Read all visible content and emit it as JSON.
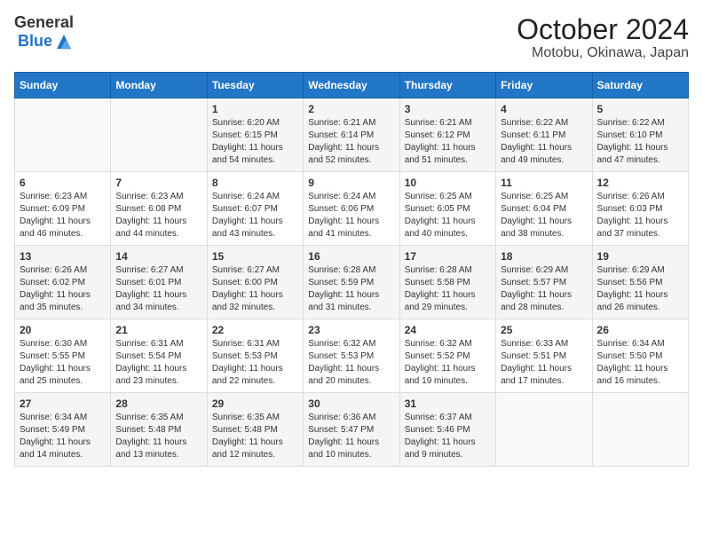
{
  "header": {
    "logo_general": "General",
    "logo_blue": "Blue",
    "title": "October 2024",
    "subtitle": "Motobu, Okinawa, Japan"
  },
  "columns": [
    "Sunday",
    "Monday",
    "Tuesday",
    "Wednesday",
    "Thursday",
    "Friday",
    "Saturday"
  ],
  "weeks": [
    [
      {
        "day": "",
        "sunrise": "",
        "sunset": "",
        "daylight": ""
      },
      {
        "day": "",
        "sunrise": "",
        "sunset": "",
        "daylight": ""
      },
      {
        "day": "1",
        "sunrise": "Sunrise: 6:20 AM",
        "sunset": "Sunset: 6:15 PM",
        "daylight": "Daylight: 11 hours and 54 minutes."
      },
      {
        "day": "2",
        "sunrise": "Sunrise: 6:21 AM",
        "sunset": "Sunset: 6:14 PM",
        "daylight": "Daylight: 11 hours and 52 minutes."
      },
      {
        "day": "3",
        "sunrise": "Sunrise: 6:21 AM",
        "sunset": "Sunset: 6:12 PM",
        "daylight": "Daylight: 11 hours and 51 minutes."
      },
      {
        "day": "4",
        "sunrise": "Sunrise: 6:22 AM",
        "sunset": "Sunset: 6:11 PM",
        "daylight": "Daylight: 11 hours and 49 minutes."
      },
      {
        "day": "5",
        "sunrise": "Sunrise: 6:22 AM",
        "sunset": "Sunset: 6:10 PM",
        "daylight": "Daylight: 11 hours and 47 minutes."
      }
    ],
    [
      {
        "day": "6",
        "sunrise": "Sunrise: 6:23 AM",
        "sunset": "Sunset: 6:09 PM",
        "daylight": "Daylight: 11 hours and 46 minutes."
      },
      {
        "day": "7",
        "sunrise": "Sunrise: 6:23 AM",
        "sunset": "Sunset: 6:08 PM",
        "daylight": "Daylight: 11 hours and 44 minutes."
      },
      {
        "day": "8",
        "sunrise": "Sunrise: 6:24 AM",
        "sunset": "Sunset: 6:07 PM",
        "daylight": "Daylight: 11 hours and 43 minutes."
      },
      {
        "day": "9",
        "sunrise": "Sunrise: 6:24 AM",
        "sunset": "Sunset: 6:06 PM",
        "daylight": "Daylight: 11 hours and 41 minutes."
      },
      {
        "day": "10",
        "sunrise": "Sunrise: 6:25 AM",
        "sunset": "Sunset: 6:05 PM",
        "daylight": "Daylight: 11 hours and 40 minutes."
      },
      {
        "day": "11",
        "sunrise": "Sunrise: 6:25 AM",
        "sunset": "Sunset: 6:04 PM",
        "daylight": "Daylight: 11 hours and 38 minutes."
      },
      {
        "day": "12",
        "sunrise": "Sunrise: 6:26 AM",
        "sunset": "Sunset: 6:03 PM",
        "daylight": "Daylight: 11 hours and 37 minutes."
      }
    ],
    [
      {
        "day": "13",
        "sunrise": "Sunrise: 6:26 AM",
        "sunset": "Sunset: 6:02 PM",
        "daylight": "Daylight: 11 hours and 35 minutes."
      },
      {
        "day": "14",
        "sunrise": "Sunrise: 6:27 AM",
        "sunset": "Sunset: 6:01 PM",
        "daylight": "Daylight: 11 hours and 34 minutes."
      },
      {
        "day": "15",
        "sunrise": "Sunrise: 6:27 AM",
        "sunset": "Sunset: 6:00 PM",
        "daylight": "Daylight: 11 hours and 32 minutes."
      },
      {
        "day": "16",
        "sunrise": "Sunrise: 6:28 AM",
        "sunset": "Sunset: 5:59 PM",
        "daylight": "Daylight: 11 hours and 31 minutes."
      },
      {
        "day": "17",
        "sunrise": "Sunrise: 6:28 AM",
        "sunset": "Sunset: 5:58 PM",
        "daylight": "Daylight: 11 hours and 29 minutes."
      },
      {
        "day": "18",
        "sunrise": "Sunrise: 6:29 AM",
        "sunset": "Sunset: 5:57 PM",
        "daylight": "Daylight: 11 hours and 28 minutes."
      },
      {
        "day": "19",
        "sunrise": "Sunrise: 6:29 AM",
        "sunset": "Sunset: 5:56 PM",
        "daylight": "Daylight: 11 hours and 26 minutes."
      }
    ],
    [
      {
        "day": "20",
        "sunrise": "Sunrise: 6:30 AM",
        "sunset": "Sunset: 5:55 PM",
        "daylight": "Daylight: 11 hours and 25 minutes."
      },
      {
        "day": "21",
        "sunrise": "Sunrise: 6:31 AM",
        "sunset": "Sunset: 5:54 PM",
        "daylight": "Daylight: 11 hours and 23 minutes."
      },
      {
        "day": "22",
        "sunrise": "Sunrise: 6:31 AM",
        "sunset": "Sunset: 5:53 PM",
        "daylight": "Daylight: 11 hours and 22 minutes."
      },
      {
        "day": "23",
        "sunrise": "Sunrise: 6:32 AM",
        "sunset": "Sunset: 5:53 PM",
        "daylight": "Daylight: 11 hours and 20 minutes."
      },
      {
        "day": "24",
        "sunrise": "Sunrise: 6:32 AM",
        "sunset": "Sunset: 5:52 PM",
        "daylight": "Daylight: 11 hours and 19 minutes."
      },
      {
        "day": "25",
        "sunrise": "Sunrise: 6:33 AM",
        "sunset": "Sunset: 5:51 PM",
        "daylight": "Daylight: 11 hours and 17 minutes."
      },
      {
        "day": "26",
        "sunrise": "Sunrise: 6:34 AM",
        "sunset": "Sunset: 5:50 PM",
        "daylight": "Daylight: 11 hours and 16 minutes."
      }
    ],
    [
      {
        "day": "27",
        "sunrise": "Sunrise: 6:34 AM",
        "sunset": "Sunset: 5:49 PM",
        "daylight": "Daylight: 11 hours and 14 minutes."
      },
      {
        "day": "28",
        "sunrise": "Sunrise: 6:35 AM",
        "sunset": "Sunset: 5:48 PM",
        "daylight": "Daylight: 11 hours and 13 minutes."
      },
      {
        "day": "29",
        "sunrise": "Sunrise: 6:35 AM",
        "sunset": "Sunset: 5:48 PM",
        "daylight": "Daylight: 11 hours and 12 minutes."
      },
      {
        "day": "30",
        "sunrise": "Sunrise: 6:36 AM",
        "sunset": "Sunset: 5:47 PM",
        "daylight": "Daylight: 11 hours and 10 minutes."
      },
      {
        "day": "31",
        "sunrise": "Sunrise: 6:37 AM",
        "sunset": "Sunset: 5:46 PM",
        "daylight": "Daylight: 11 hours and 9 minutes."
      },
      {
        "day": "",
        "sunrise": "",
        "sunset": "",
        "daylight": ""
      },
      {
        "day": "",
        "sunrise": "",
        "sunset": "",
        "daylight": ""
      }
    ]
  ]
}
